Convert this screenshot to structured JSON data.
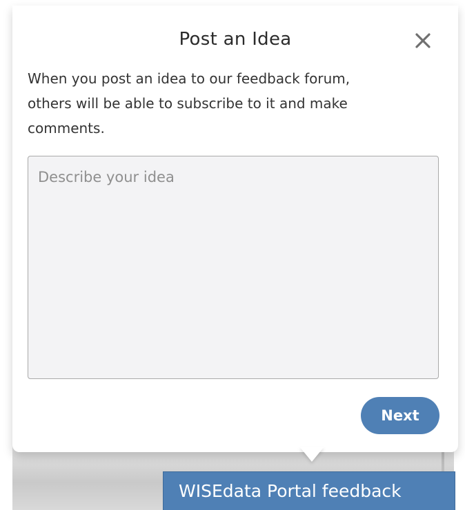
{
  "popup": {
    "title": "Post an Idea",
    "close_icon": "close-icon",
    "intro_line1": "When you post an idea to our feedback forum,",
    "intro_line2": "others will be able to subscribe to it and make",
    "intro_line3": "comments.",
    "idea_input": {
      "value": "",
      "placeholder": "Describe your idea"
    },
    "next_label": "Next"
  },
  "feedback_tab": {
    "label": "WISEdata Portal feedback"
  },
  "colors": {
    "accent": "#4f80b5",
    "input_bg": "#f3f3f5",
    "text": "#333333"
  }
}
